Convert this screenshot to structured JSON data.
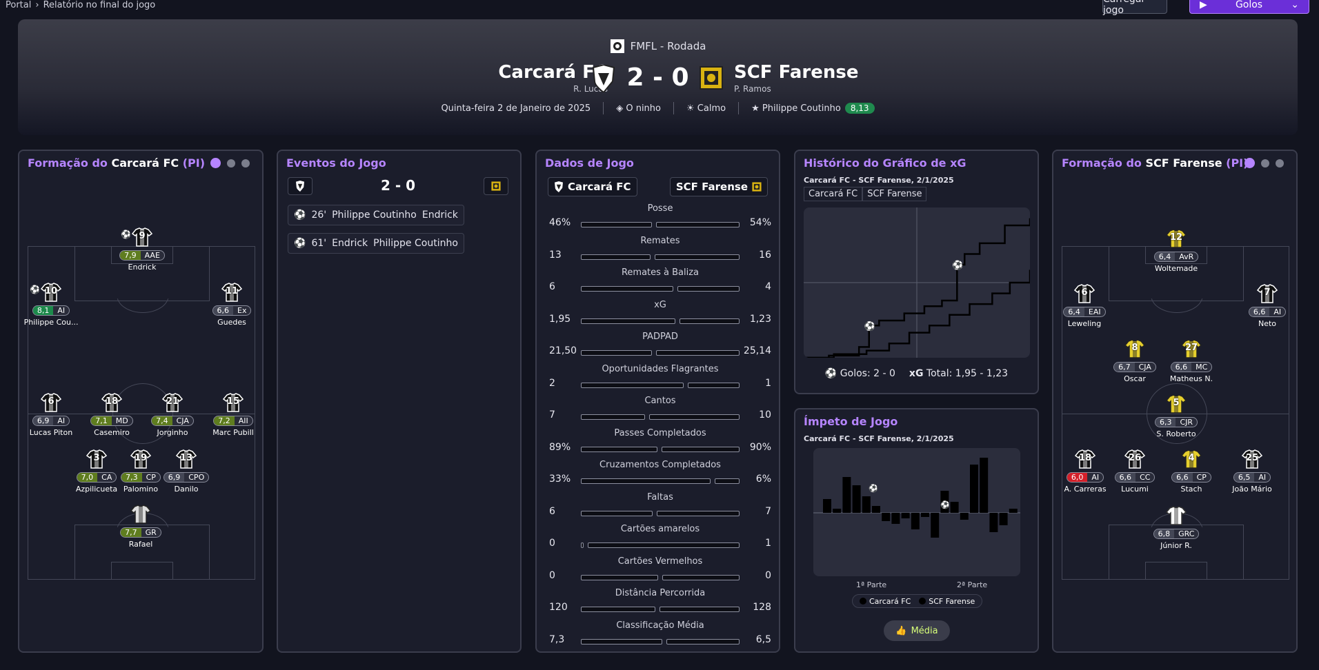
{
  "breadcrumb": {
    "root": "Portal",
    "current": "Relatório no final do jogo"
  },
  "actions": {
    "load_label": "Carregar jogo",
    "goals_label": "Golos"
  },
  "match": {
    "competition": "FMFL - Rodada",
    "home": {
      "name": "Carcará FC",
      "coach": "R. Lucas",
      "short": "Carcará FC"
    },
    "away": {
      "name": "SCF Farense",
      "coach": "P. Ramos",
      "short": "SCF Farense"
    },
    "score": "2 - 0",
    "date": "Quinta-feira 2 de Janeiro de 2025",
    "venue": "O ninho",
    "weather": "Calmo",
    "potm": "Philippe Coutinho",
    "potm_rating": "8,13"
  },
  "home_lineup": {
    "title_prefix": "Formação do",
    "team": "Carcará FC",
    "suffix": "(PI)",
    "players": [
      {
        "num": "9",
        "rating": "7,9",
        "pos": "AAE",
        "name": "Endrick",
        "rc": "o"
      },
      {
        "num": "10",
        "rating": "8,1",
        "pos": "AI",
        "name": "Philippe Cou...",
        "rc": "g"
      },
      {
        "num": "11",
        "rating": "6,6",
        "pos": "Ex",
        "name": "Guedes",
        "rc": "n"
      },
      {
        "num": "6",
        "rating": "6,9",
        "pos": "AI",
        "name": "Lucas Piton",
        "rc": "n"
      },
      {
        "num": "18",
        "rating": "7,1",
        "pos": "MD",
        "name": "Casemiro",
        "rc": "o"
      },
      {
        "num": "21",
        "rating": "7,4",
        "pos": "CJA",
        "name": "Jorginho",
        "rc": "o"
      },
      {
        "num": "15",
        "rating": "7,2",
        "pos": "AII",
        "name": "Marc Pubill",
        "rc": "o"
      },
      {
        "num": "3",
        "rating": "7,0",
        "pos": "CA",
        "name": "Azpilicueta",
        "rc": "o"
      },
      {
        "num": "19",
        "rating": "7,3",
        "pos": "CP",
        "name": "Palomino",
        "rc": "o"
      },
      {
        "num": "13",
        "rating": "6,9",
        "pos": "CPO",
        "name": "Danilo",
        "rc": "n"
      },
      {
        "num": "",
        "rating": "7,7",
        "pos": "GR",
        "name": "Rafael",
        "rc": "o"
      }
    ]
  },
  "away_lineup": {
    "title_prefix": "Formação do",
    "team": "SCF Farense",
    "suffix": "(PI)",
    "players": [
      {
        "num": "12",
        "rating": "6,4",
        "pos": "AvR",
        "name": "Woltemade",
        "rc": "n"
      },
      {
        "num": "6",
        "rating": "6,4",
        "pos": "EAI",
        "name": "Leweling",
        "rc": "n"
      },
      {
        "num": "7",
        "rating": "6,6",
        "pos": "AI",
        "name": "Neto",
        "rc": "n"
      },
      {
        "num": "8",
        "rating": "6,7",
        "pos": "CJA",
        "name": "Oscar",
        "rc": "n"
      },
      {
        "num": "27",
        "rating": "6,6",
        "pos": "MC",
        "name": "Matheus N.",
        "rc": "n"
      },
      {
        "num": "5",
        "rating": "6,3",
        "pos": "CJR",
        "name": "S. Roberto",
        "rc": "n"
      },
      {
        "num": "18",
        "rating": "6,0",
        "pos": "AI",
        "name": "A. Carreras",
        "rc": "red"
      },
      {
        "num": "26",
        "rating": "6,6",
        "pos": "CC",
        "name": "Lucumi",
        "rc": "n"
      },
      {
        "num": "4",
        "rating": "6,6",
        "pos": "CP",
        "name": "Stach",
        "rc": "n"
      },
      {
        "num": "25",
        "rating": "6,5",
        "pos": "AI",
        "name": "João Mário",
        "rc": "n"
      },
      {
        "num": "",
        "rating": "6,8",
        "pos": "GRC",
        "name": "Júnior R.",
        "rc": "n"
      }
    ]
  },
  "events": {
    "title": "Eventos do Jogo",
    "score": "2 - 0",
    "items": [
      {
        "minute": "26'",
        "scorer": "Philippe Coutinho",
        "assist": "Endrick"
      },
      {
        "minute": "61'",
        "scorer": "Endrick",
        "assist": "Philippe Coutinho"
      }
    ]
  },
  "stats": {
    "title": "Dados de Jogo",
    "rows": [
      {
        "label": "Posse",
        "home": "46%",
        "away": "54%",
        "h": 46,
        "a": 54
      },
      {
        "label": "Remates",
        "home": "13",
        "away": "16",
        "h": 13,
        "a": 16
      },
      {
        "label": "Remates à Baliza",
        "home": "6",
        "away": "4",
        "h": 6,
        "a": 4
      },
      {
        "label": "xG",
        "home": "1,95",
        "away": "1,23",
        "h": 1.95,
        "a": 1.23
      },
      {
        "label": "PADPAD",
        "home": "21,50",
        "away": "25,14",
        "h": 21.5,
        "a": 25.14
      },
      {
        "label": "Oportunidades Flagrantes",
        "home": "2",
        "away": "1",
        "h": 2,
        "a": 1
      },
      {
        "label": "Cantos",
        "home": "7",
        "away": "10",
        "h": 7,
        "a": 10
      },
      {
        "label": "Passes Completados",
        "home": "89%",
        "away": "90%",
        "h": 89,
        "a": 90
      },
      {
        "label": "Cruzamentos Completados",
        "home": "33%",
        "away": "6%",
        "h": 33,
        "a": 6
      },
      {
        "label": "Faltas",
        "home": "6",
        "away": "7",
        "h": 6,
        "a": 7
      },
      {
        "label": "Cartões amarelos",
        "home": "0",
        "away": "1",
        "h": 0,
        "a": 1
      },
      {
        "label": "Cartões Vermelhos",
        "home": "0",
        "away": "0",
        "h": 0,
        "a": 0
      },
      {
        "label": "Distância Percorrida",
        "home": "120",
        "away": "128",
        "h": 120,
        "a": 128
      },
      {
        "label": "Classificação Média",
        "home": "7,3",
        "away": "6,5",
        "h": 7.3,
        "a": 6.5
      }
    ]
  },
  "xg_panel": {
    "title": "Histórico do Gráfico de xG",
    "subtitle": "Carcará FC - SCF Farense, 2/1/2025",
    "tabs": [
      "Carcará FC",
      "SCF Farense"
    ],
    "goals_label": "Golos:",
    "goals_value": "2 - 0",
    "xg_label": "xG",
    "xg_total_label": "Total:",
    "xg_total_value": "1,95 - 1,23"
  },
  "momentum": {
    "title": "Ímpeto de Jogo",
    "subtitle": "Carcará FC - SCF Farense, 2/1/2025",
    "half1": "1ª Parte",
    "half2": "2ª Parte",
    "legend": [
      "Carcará FC",
      "SCF Farense"
    ],
    "average_label": "Média"
  },
  "chart_data": [
    {
      "type": "line",
      "title": "Histórico do Gráfico de xG",
      "series": [
        {
          "name": "Carcará FC",
          "x": [
            0,
            10,
            22,
            26,
            30,
            40,
            48,
            55,
            61,
            64,
            70,
            80,
            90
          ],
          "values": [
            0,
            0.03,
            0.15,
            0.45,
            0.52,
            0.62,
            0.72,
            0.8,
            1.3,
            1.45,
            1.6,
            1.85,
            1.95
          ]
        },
        {
          "name": "SCF Farense",
          "x": [
            0,
            12,
            25,
            34,
            42,
            50,
            58,
            66,
            75,
            82,
            90
          ],
          "values": [
            0,
            0.05,
            0.1,
            0.2,
            0.35,
            0.45,
            0.6,
            0.75,
            0.9,
            1.05,
            1.23
          ]
        }
      ],
      "xlim": [
        0,
        90
      ]
    },
    {
      "type": "bar",
      "title": "Ímpeto de Jogo",
      "values": [
        1,
        0.3,
        2.6,
        2,
        1.2,
        0.5,
        -0.6,
        -0.8,
        -0.4,
        -1.2,
        -0.3,
        -1.8,
        1.6,
        0.8,
        -0.5,
        3.5,
        4,
        -1.4,
        -0.9,
        0.3
      ]
    }
  ]
}
